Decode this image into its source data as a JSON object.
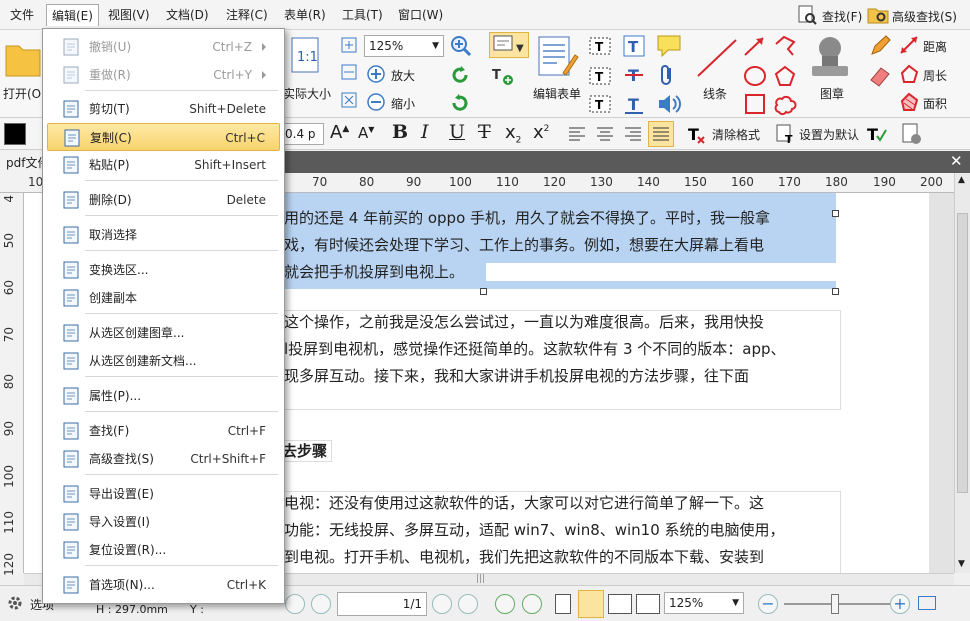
{
  "menubar": {
    "items": [
      "文件",
      "编辑(E)",
      "视图(V)",
      "文档(D)",
      "注释(C)",
      "表单(R)",
      "工具(T)",
      "窗口(W)"
    ],
    "find": "查找(F)",
    "adv_find": "高级查找(S)"
  },
  "ribbon": {
    "open": "打开(O)",
    "actual_size": "实际大小",
    "zoom": "125%",
    "zoom_in": "放大",
    "zoom_out": "缩小",
    "edit_form": "编辑表单",
    "lines": "线条",
    "stamp": "图章",
    "distance": "距离",
    "perimeter": "周长",
    "area": "面积"
  },
  "format": {
    "font_size": "0.4 p",
    "clear_format": "清除格式",
    "set_default": "设置为默认"
  },
  "tab": {
    "title": "pdf文件"
  },
  "ruler": {
    "h_ticks": [
      "10",
      "70",
      "80",
      "90",
      "100",
      "110",
      "120",
      "130",
      "140",
      "150",
      "160",
      "170",
      "180",
      "190",
      "200"
    ],
    "v_ticks": [
      "4",
      "50",
      "60",
      "70",
      "80",
      "90",
      "100",
      "110",
      "120"
    ]
  },
  "doc": {
    "p1": [
      "用的还是 4 年前买的 oppo 手机，用久了就会不得换了。平时，我一般拿",
      "戏，有时候还会处理下学习、工作上的事务。例如，想要在大屏幕上看电",
      "就会把手机投屏到电视上。"
    ],
    "p2": [
      "这个操作，之前我是没怎么尝试过，一直以为难度很高。后来，我用快投",
      "l投屏到电视机，感觉操作还挺简单的。这款软件有 3 个不同的版本：app、",
      "现多屏互动。接下来，我和大家讲讲手机投屏电视的方法步骤，往下面"
    ],
    "heading": "去步骤",
    "p3": [
      "电视：还没有使用过这款软件的话，大家可以对它进行简单了解一下。这",
      "功能：无线投屏、多屏互动，适配 win7、win8、win10 系统的电脑使用，",
      "到电视。打开手机、电视机，我们先把这款软件的不同版本下载、安装到"
    ]
  },
  "menu": {
    "items": [
      {
        "label": "撤销(U)",
        "shortcut": "Ctrl+Z",
        "icon": "undo-icon",
        "disabled": true,
        "submenu": true
      },
      {
        "label": "重做(R)",
        "shortcut": "Ctrl+Y",
        "icon": "redo-icon",
        "disabled": true,
        "submenu": true
      },
      {
        "label": "剪切(T)",
        "shortcut": "Shift+Delete",
        "icon": "scissors-icon"
      },
      {
        "label": "复制(C)",
        "shortcut": "Ctrl+C",
        "icon": "copy-icon",
        "highlighted": true
      },
      {
        "label": "粘贴(P)",
        "shortcut": "Shift+Insert",
        "icon": "paste-icon"
      },
      {
        "label": "删除(D)",
        "shortcut": "Delete",
        "icon": "trash-icon"
      },
      {
        "label": "取消选择",
        "shortcut": "",
        "icon": "deselect-icon"
      },
      {
        "label": "变换选区...",
        "shortcut": "",
        "icon": "transform-selection-icon"
      },
      {
        "label": "创建副本",
        "shortcut": "",
        "icon": "duplicate-icon"
      },
      {
        "label": "从选区创建图章...",
        "shortcut": "",
        "icon": "stamp-from-selection-icon"
      },
      {
        "label": "从选区创建新文档...",
        "shortcut": "",
        "icon": "new-doc-from-selection-icon"
      },
      {
        "label": "属性(P)...",
        "shortcut": "",
        "icon": "properties-icon"
      },
      {
        "label": "查找(F)",
        "shortcut": "Ctrl+F",
        "icon": "find-icon"
      },
      {
        "label": "高级查找(S)",
        "shortcut": "Ctrl+Shift+F",
        "icon": "advanced-find-icon"
      },
      {
        "label": "导出设置(E)",
        "shortcut": "",
        "icon": "export-settings-icon"
      },
      {
        "label": "导入设置(I)",
        "shortcut": "",
        "icon": "import-settings-icon"
      },
      {
        "label": "复位设置(R)...",
        "shortcut": "",
        "icon": "reset-settings-icon"
      },
      {
        "label": "首选项(N)...",
        "shortcut": "Ctrl+K",
        "icon": "preferences-icon"
      }
    ]
  },
  "status": {
    "options": "选项",
    "height": "H : 297.0mm",
    "y": "Y :",
    "page": "1/1",
    "zoom": "125%"
  },
  "colors": {
    "selection": "#b9d4f3",
    "menu_highlight": "#f8d36d",
    "accent_red": "#d9262c"
  }
}
